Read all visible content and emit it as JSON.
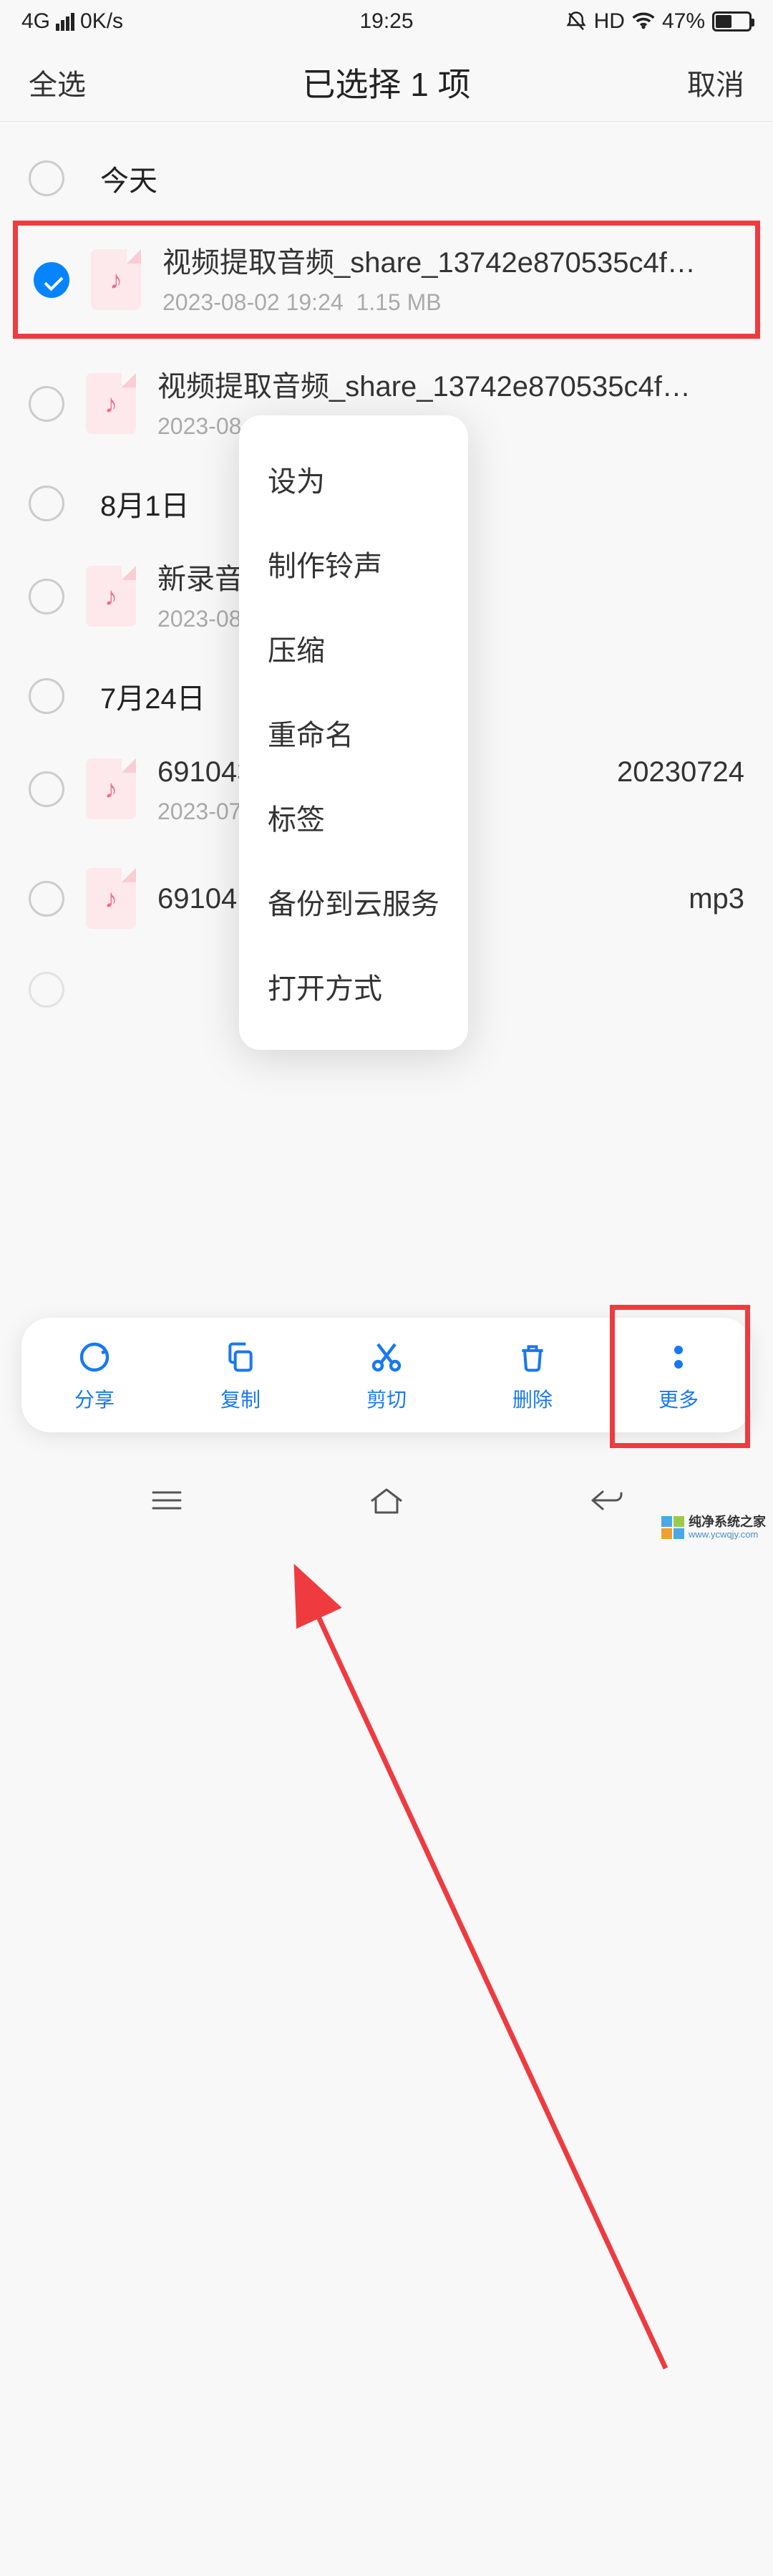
{
  "status": {
    "network": "4G",
    "speed": "0K/s",
    "time": "19:25",
    "hd": "HD",
    "battery_pct": "47%"
  },
  "header": {
    "select_all": "全选",
    "title": "已选择 1 项",
    "cancel": "取消"
  },
  "sections": [
    {
      "title": "今天",
      "items": [
        {
          "name": "视频提取音频_share_13742e870535c4f…",
          "date": "2023-08-02 19:24",
          "size": "1.15 MB",
          "checked": true,
          "highlighted": true
        },
        {
          "name": "视频提取音频_share_13742e870535c4f…",
          "date": "2023-08",
          "size": "",
          "checked": false
        }
      ]
    },
    {
      "title": "8月1日",
      "items": [
        {
          "name": "新录音",
          "date": "2023-08",
          "size": "",
          "checked": false
        }
      ]
    },
    {
      "title": "7月24日",
      "items": [
        {
          "name": "6910430724",
          "name_right": "20230724",
          "date": "2023-07",
          "size": "",
          "checked": false
        },
        {
          "name": "69104",
          "name_right": "mp3",
          "date": "",
          "size": "",
          "checked": false
        }
      ]
    }
  ],
  "popup": {
    "items": [
      "设为",
      "制作铃声",
      "压缩",
      "重命名",
      "标签",
      "备份到云服务",
      "打开方式"
    ]
  },
  "bottom": {
    "share": "分享",
    "copy": "复制",
    "cut": "剪切",
    "delete": "删除",
    "more": "更多"
  },
  "watermark": {
    "name": "纯净系统之家",
    "url": "www.ycwqjy.com"
  }
}
